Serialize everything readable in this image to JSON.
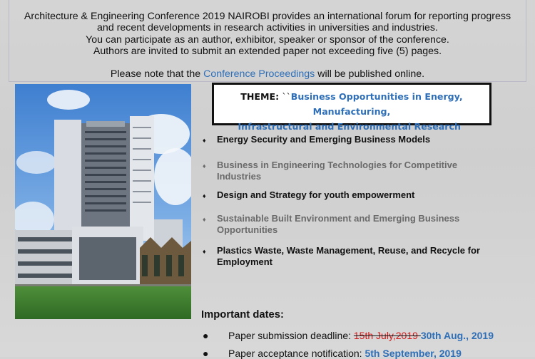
{
  "intro": {
    "line1": "Architecture & Engineering Conference 2019 NAIROBI provides an international forum for reporting progress",
    "line2": "and recent developments in research activities in universities and industries.",
    "line3": "You can participate as an author, exhibitor, speaker or sponsor of the conference.",
    "line4": "Authors are invited to submit an extended paper not exceeding five (5) pages.",
    "note_prefix": "Please note that the ",
    "note_link": "Conference Proceedings",
    "note_suffix": " will be published online."
  },
  "theme": {
    "label": "THEME:",
    "open_quote": " ``",
    "text_line1": "Business Opportunities in Energy, Manufacturing,",
    "text_line2": "Infrastructural and Environmental Research",
    "close_quote": "”"
  },
  "topics": [
    {
      "bullet": "♦",
      "text": "Energy Security and Emerging Business Models"
    },
    {
      "bullet": "♦",
      "text": "Business in Engineering Technologies for Competitive Industries"
    },
    {
      "bullet": "♦",
      "text": "Design and Strategy for youth empowerment"
    },
    {
      "bullet": "♦",
      "text": "Sustainable Built Environment and Emerging Business Opportunities"
    },
    {
      "bullet": "♦",
      "text": "Plastics Waste, Waste Management, Reuse, and Recycle for Employment"
    }
  ],
  "important_dates": {
    "title": "Important dates:",
    "rows": [
      {
        "bullet": "●",
        "label": "Paper submission deadline: ",
        "old_date": "15th July,2019 ",
        "new_date": "30th Aug., 2019"
      },
      {
        "bullet": "●",
        "label": "Paper acceptance notification: ",
        "new_date": "5th September, 2019"
      }
    ]
  },
  "colors": {
    "accent": "#2e6fb8",
    "struck_date": "#d31b1b",
    "background": "#d4d4d4"
  }
}
